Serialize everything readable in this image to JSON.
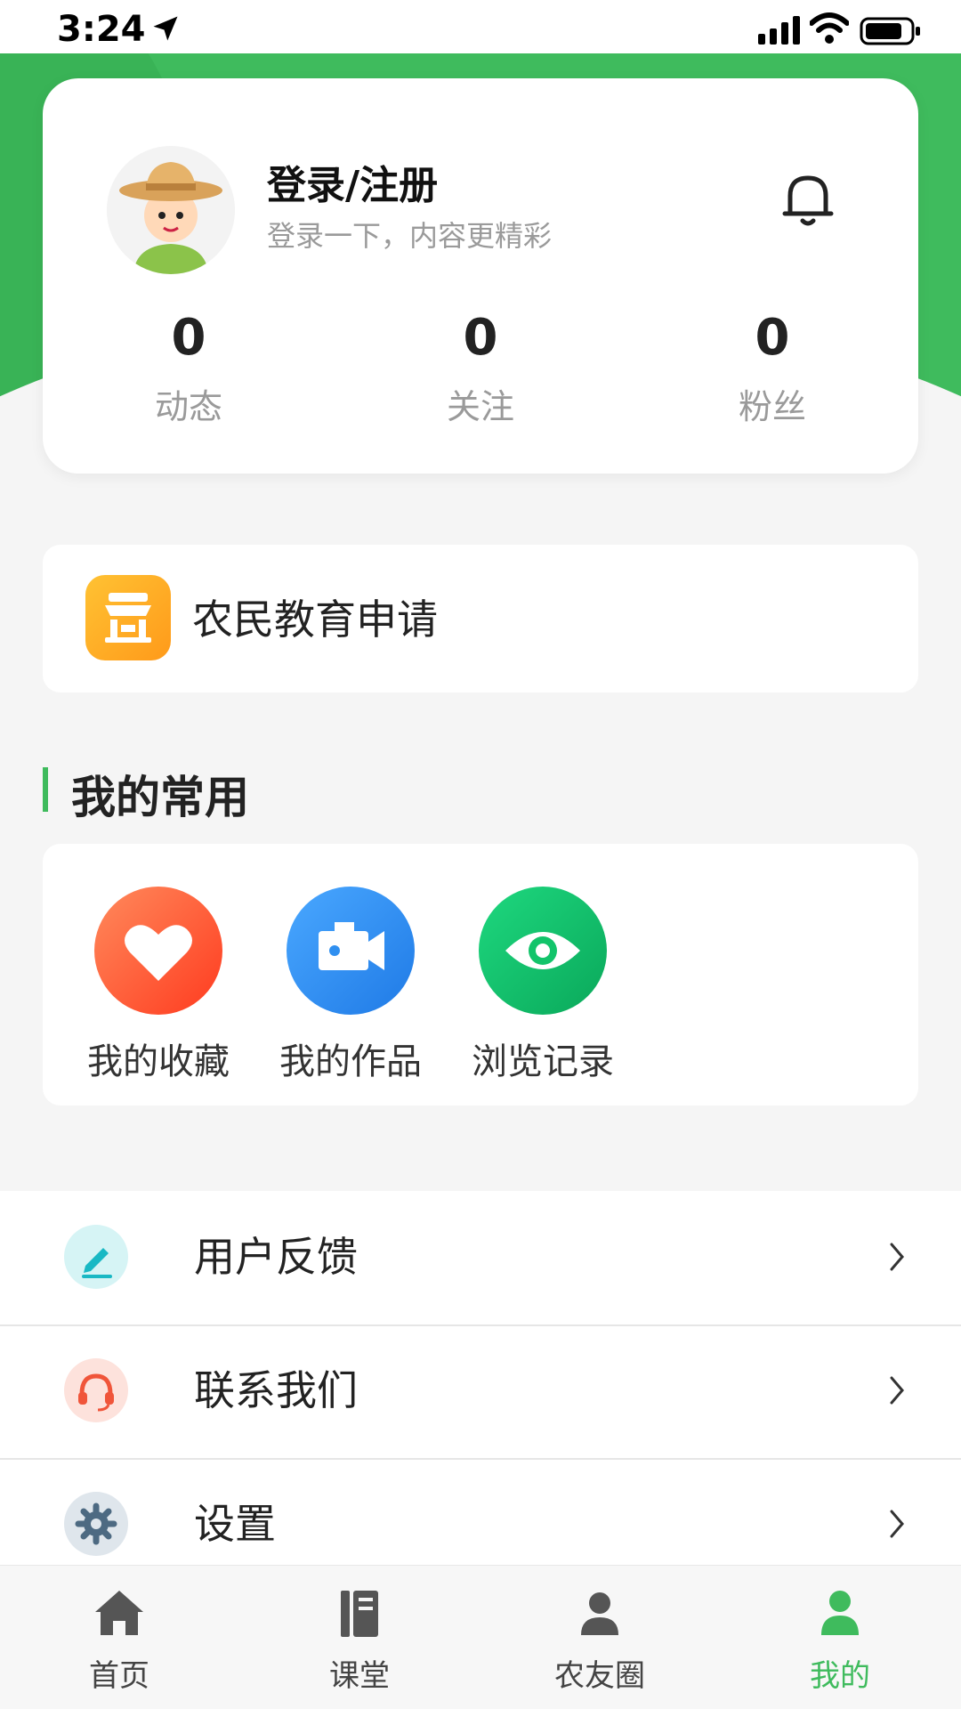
{
  "status_bar": {
    "time": "3:24"
  },
  "profile": {
    "title": "登录/注册",
    "subtitle": "登录一下，内容更精彩",
    "stats": [
      {
        "value": "0",
        "label": "动态"
      },
      {
        "value": "0",
        "label": "关注"
      },
      {
        "value": "0",
        "label": "粉丝"
      }
    ]
  },
  "apply": {
    "label": "农民教育申请"
  },
  "frequent": {
    "title": "我的常用",
    "items": [
      {
        "label": "我的收藏",
        "icon": "heart-icon"
      },
      {
        "label": "我的作品",
        "icon": "video-camera-icon"
      },
      {
        "label": "浏览记录",
        "icon": "eye-icon"
      }
    ]
  },
  "menu": [
    {
      "label": "用户反馈",
      "icon": "pen-icon"
    },
    {
      "label": "联系我们",
      "icon": "headset-icon"
    },
    {
      "label": "设置",
      "icon": "gear-icon"
    }
  ],
  "bottom_nav": [
    {
      "label": "首页",
      "icon": "home-icon"
    },
    {
      "label": "课堂",
      "icon": "book-icon"
    },
    {
      "label": "农友圈",
      "icon": "community-icon"
    },
    {
      "label": "我的",
      "icon": "person-icon"
    }
  ],
  "colors": {
    "accent": "#3fbb5d",
    "apply_icon": "#ffaa22",
    "favorite": "#ff5a36",
    "works": "#2f8ff0",
    "history": "#12c46a"
  }
}
